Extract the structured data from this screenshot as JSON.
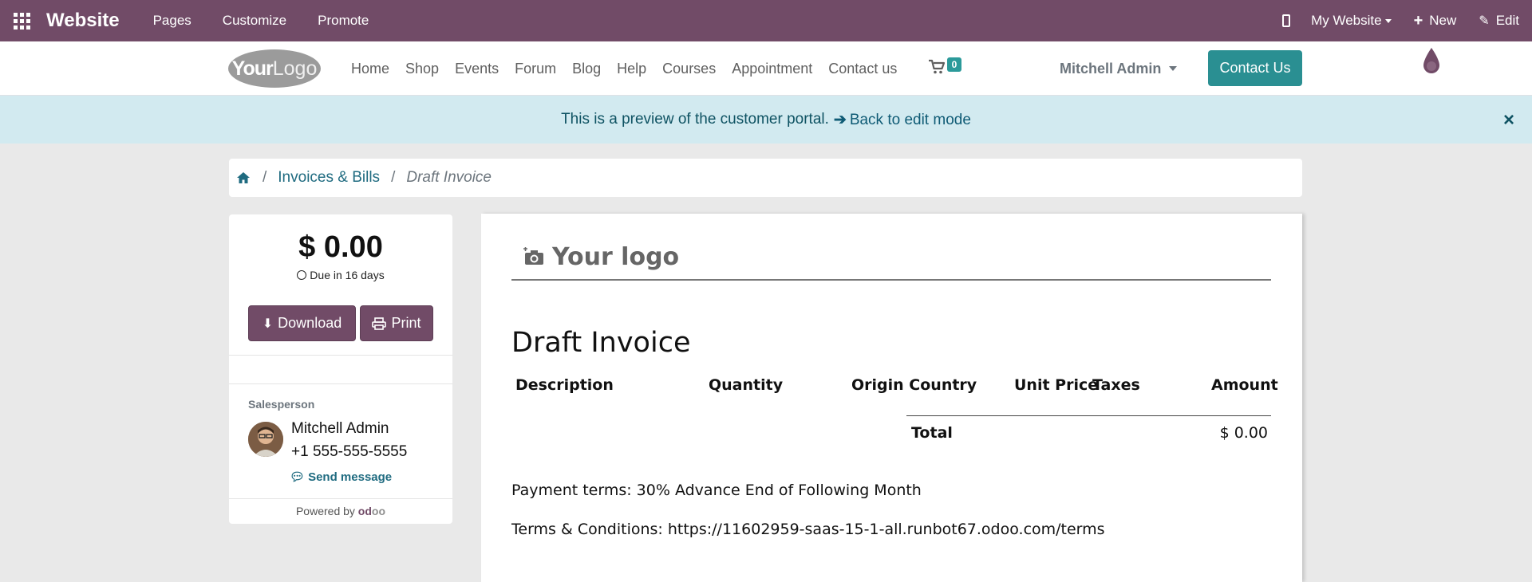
{
  "admin_bar": {
    "app_name": "Website",
    "menus": [
      "Pages",
      "Customize",
      "Promote"
    ],
    "site_switcher": "My Website",
    "new_label": "New",
    "edit_label": "Edit"
  },
  "header": {
    "logo": {
      "bold": "Your",
      "light": "Logo"
    },
    "nav": [
      "Home",
      "Shop",
      "Events",
      "Forum",
      "Blog",
      "Help",
      "Courses",
      "Appointment",
      "Contact us"
    ],
    "cart_count": "0",
    "user": "Mitchell Admin",
    "cta": "Contact Us"
  },
  "banner": {
    "text": "This is a preview of the customer portal.",
    "link": "Back to edit mode"
  },
  "breadcrumb": {
    "items": [
      "Invoices & Bills",
      "Draft Invoice"
    ]
  },
  "sidebar": {
    "amount": "$ 0.00",
    "due": "Due in 16 days",
    "download_label": "Download",
    "print_label": "Print",
    "salesperson_label": "Salesperson",
    "salesperson_name": "Mitchell Admin",
    "salesperson_phone": "+1 555-555-5555",
    "send_message": "Send message",
    "powered_by": "Powered by",
    "powered_brand_a": "od",
    "powered_brand_b": "oo"
  },
  "invoice": {
    "logo_placeholder": "Your logo",
    "title": "Draft Invoice",
    "columns": [
      "Description",
      "Quantity",
      "Origin Country",
      "Unit Price",
      "Taxes",
      "Amount"
    ],
    "total_label": "Total",
    "total_value": "$ 0.00",
    "payment_terms": "Payment terms: 30% Advance End of Following Month",
    "terms_conditions": "Terms & Conditions: https://11602959-saas-15-1-all.runbot67.odoo.com/terms"
  },
  "colors": {
    "brand": "#714b67",
    "accent": "#2a8f92",
    "banner_bg": "#d2eaf0"
  }
}
